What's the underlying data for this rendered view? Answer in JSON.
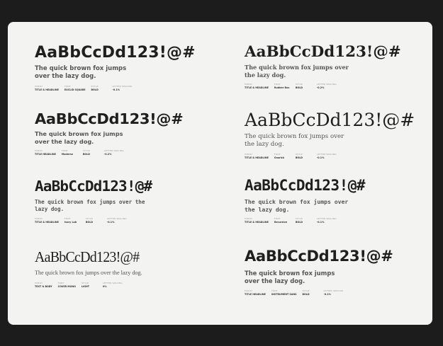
{
  "specimens": [
    {
      "headline": "AaBbCcDd123!@#",
      "sample": "The quick brown fox jumps over the lazy dog.",
      "meta": [
        {
          "label": "FAMILY",
          "value": "TITLE & HEADLINE"
        },
        {
          "label": "FONT",
          "value": "EUCLID SQUARE"
        },
        {
          "label": "STYLE",
          "value": "BOLD"
        },
        {
          "label": "LETTER SPACING",
          "value": "-0.1%"
        }
      ]
    },
    {
      "headline": "AaBbCcDd123!@#",
      "sample": "The quick brown fox jumps over the lazy dog.",
      "meta": [
        {
          "label": "FAMILY",
          "value": "TITLE & HEADLINE"
        },
        {
          "label": "FONT",
          "value": "Rubber Bus"
        },
        {
          "label": "STYLE",
          "value": "BOLD"
        },
        {
          "label": "LETTER SPACING",
          "value": "-0.2%"
        }
      ]
    },
    {
      "headline": "AaBbCcDd123!@#",
      "sample": "The quick brown fox jumps over the lazy dog.",
      "meta": [
        {
          "label": "FAMILY",
          "value": "TITLE HEADLINE"
        },
        {
          "label": "FONT",
          "value": "Modernz"
        },
        {
          "label": "STYLE",
          "value": "BOLD"
        },
        {
          "label": "LETTER SPACING",
          "value": "-0.2%"
        }
      ]
    },
    {
      "headline": "AaBbCcDd123!@#",
      "sample": "The quick brown fox jumps over the lazy dog.",
      "meta": [
        {
          "label": "FAMILY",
          "value": "TITLE & HEADLINE"
        },
        {
          "label": "FONT",
          "value": "Gnarick"
        },
        {
          "label": "STYLE",
          "value": "BOLD"
        },
        {
          "label": "LETTER SPACING",
          "value": "-0.1%"
        }
      ]
    },
    {
      "headline": "AaBbCcDd123!@#",
      "sample": "The quick brown fox jumps over the lazy dog.",
      "meta": [
        {
          "label": "FAMILY",
          "value": "TITLE & HEADLINE"
        },
        {
          "label": "FONT",
          "value": "Ivory Lab"
        },
        {
          "label": "STYLE",
          "value": "BOLD"
        },
        {
          "label": "LETTER SPACING",
          "value": "-0.1%"
        }
      ]
    },
    {
      "headline": "AaBbCcDd123!@#",
      "sample": "The quick brown fox jumps over the lazy dog.",
      "meta": [
        {
          "label": "FAMILY",
          "value": "TITLE & HEADLINE"
        },
        {
          "label": "FONT",
          "value": "Recursive"
        },
        {
          "label": "STYLE",
          "value": "BOLD"
        },
        {
          "label": "LETTER SPACING",
          "value": "-0.1%"
        }
      ]
    },
    {
      "headline": "AaBbCcDd123!@#",
      "sample": "The quick brown fox jumps over the lazy dog.",
      "meta": [
        {
          "label": "FAMILY",
          "value": "TEXT & BODY"
        },
        {
          "label": "FONT",
          "value": "COVER MONO"
        },
        {
          "label": "STYLE",
          "value": "LIGHT"
        },
        {
          "label": "LETTER SPACING",
          "value": "0%"
        }
      ]
    },
    {
      "headline": "AaBbCcDd123!@#",
      "sample": "The quick brown fox jumps over the lazy dog.",
      "meta": [
        {
          "label": "FAMILY",
          "value": "TITLE HEADLINE"
        },
        {
          "label": "FONT",
          "value": "INSTRUMENT SANS"
        },
        {
          "label": "STYLE",
          "value": "BOLD"
        },
        {
          "label": "LETTER SPACING",
          "value": "-0.1%"
        }
      ]
    }
  ]
}
